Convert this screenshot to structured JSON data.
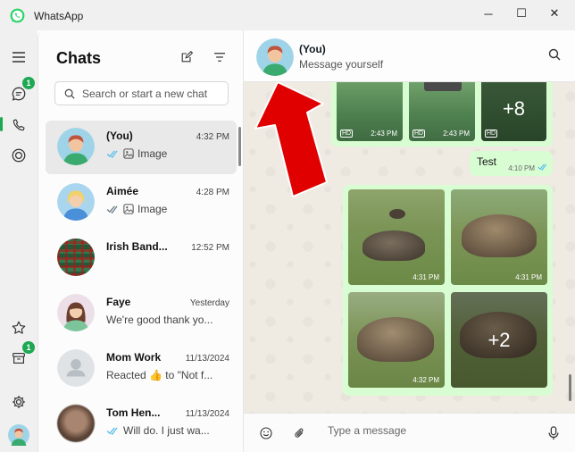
{
  "app": {
    "title": "WhatsApp"
  },
  "window_controls": {
    "minimize": "─",
    "maximize": "☐",
    "close": "✕"
  },
  "rail": {
    "chats_badge": "1",
    "archived_badge": "1",
    "accent_color": "#1da851"
  },
  "chat_list": {
    "title": "Chats",
    "search_placeholder": "Search or start a new chat",
    "items": [
      {
        "name": "(You)",
        "time": "4:32 PM",
        "preview": "Image",
        "ticks": "read",
        "has_image_icon": true,
        "selected": true
      },
      {
        "name": "Aimée",
        "time": "4:28 PM",
        "preview": "Image",
        "ticks": "delivered",
        "has_image_icon": true
      },
      {
        "name": "Irish Band...",
        "time": "12:52 PM",
        "preview": ""
      },
      {
        "name": "Faye",
        "time": "Yesterday",
        "preview": "We're good thank yo..."
      },
      {
        "name": "Mom Work",
        "time": "11/13/2024",
        "preview": "Reacted 👍 to \"Not f..."
      },
      {
        "name": "Tom Hen...",
        "time": "11/13/2024",
        "preview": "Will do. I just wa...",
        "ticks": "read"
      }
    ]
  },
  "conversation": {
    "name": "(You)",
    "subtitle": "Message yourself",
    "top_album": {
      "stamps": [
        "2:43 PM",
        "2:43 PM"
      ],
      "hd_label": "HD",
      "more_count": "+8"
    },
    "text_message": {
      "text": "Test",
      "time": "4:10 PM"
    },
    "photo_album": {
      "stamps": [
        "4:31 PM",
        "4:31 PM",
        "4:32 PM"
      ],
      "more_count": "+2"
    },
    "composer_placeholder": "Type a message"
  },
  "colors": {
    "outgoing_bubble": "#d9fdd3",
    "chat_background": "#efeae2",
    "read_tick": "#53bdeb",
    "annotation_arrow": "#e10000"
  },
  "icons": [
    "whatsapp-logo-icon",
    "menu-icon",
    "chats-icon",
    "calls-icon",
    "status-icon",
    "starred-icon",
    "archived-icon",
    "settings-icon",
    "new-chat-icon",
    "filter-icon",
    "search-icon",
    "emoji-icon",
    "attach-icon",
    "mic-icon",
    "image-icon",
    "double-check-icon"
  ]
}
